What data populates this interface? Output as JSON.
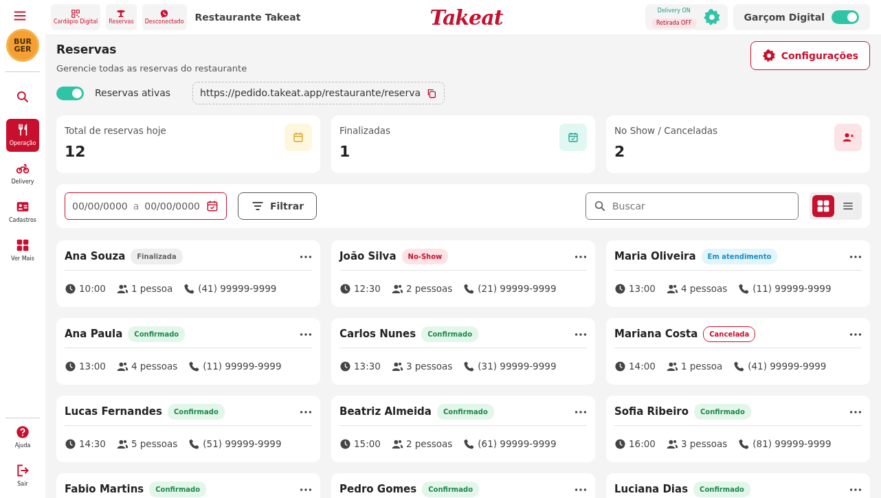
{
  "topbar": {
    "shortcuts": [
      {
        "label": "Cardápio Digital"
      },
      {
        "label": "Reservas"
      },
      {
        "label": "Desconectado"
      }
    ],
    "restaurant": "Restaurante Takeat",
    "logo": "Takeat",
    "services": [
      {
        "label": "Delivery ON",
        "on": true
      },
      {
        "label": "Retirada OFF",
        "on": false
      }
    ],
    "waiter": {
      "label": "Garçom Digital",
      "on": true
    }
  },
  "sidebar": {
    "avatar": [
      "BUR",
      "GER"
    ],
    "items": [
      {
        "selected": false
      },
      {
        "label": "Operação",
        "selected": true
      },
      {
        "label": "Delivery",
        "selected": false
      },
      {
        "label": "Cadastros",
        "selected": false
      },
      {
        "label": "Ver Mais",
        "selected": false
      }
    ],
    "bottom": [
      {
        "label": "Ajuda"
      },
      {
        "label": "Sair"
      }
    ]
  },
  "page": {
    "title": "Reservas",
    "subtitle": "Gerencie todas as reservas do restaurante",
    "settings_button": "Configurações",
    "active_toggle": {
      "label": "Reservas ativas",
      "on": true
    },
    "link": "https://pedido.takeat.app/restaurante/reserva"
  },
  "stats": [
    {
      "label": "Total de reservas hoje",
      "value": "12",
      "kind": "total"
    },
    {
      "label": "Finalizadas",
      "value": "1",
      "kind": "done"
    },
    {
      "label": "No Show / Canceladas",
      "value": "2",
      "kind": "cancel"
    }
  ],
  "filters": {
    "date_from": "00/00/0000",
    "separator": "a",
    "date_to": "00/00/0000",
    "filter_button": "Filtrar",
    "search_placeholder": "Buscar",
    "views": [
      {
        "kind": "grid",
        "selected": true
      },
      {
        "kind": "list",
        "selected": false
      }
    ]
  },
  "reservations": [
    {
      "name": "Ana Souza",
      "status": "Finalizada",
      "kind": "finalizada",
      "time": "10:00",
      "people": "1 pessoa",
      "phone": "(41) 99999-9999"
    },
    {
      "name": "João Silva",
      "status": "No-Show",
      "kind": "noshow",
      "time": "12:30",
      "people": "2 pessoas",
      "phone": "(21) 99999-9999"
    },
    {
      "name": "Maria Oliveira",
      "status": "Em atendimento",
      "kind": "atendimento",
      "time": "13:00",
      "people": "4 pessoas",
      "phone": "(11) 99999-9999"
    },
    {
      "name": "Ana Paula",
      "status": "Confirmado",
      "kind": "confirmado",
      "time": "13:00",
      "people": "4 pessoas",
      "phone": "(11) 99999-9999"
    },
    {
      "name": "Carlos Nunes",
      "status": "Confirmado",
      "kind": "confirmado",
      "time": "13:30",
      "people": "3 pessoas",
      "phone": "(31) 99999-9999"
    },
    {
      "name": "Mariana Costa",
      "status": "Cancelada",
      "kind": "cancelada",
      "time": "14:00",
      "people": "1 pessoa",
      "phone": "(41) 99999-9999"
    },
    {
      "name": "Lucas Fernandes",
      "status": "Confirmado",
      "kind": "confirmado",
      "time": "14:30",
      "people": "5 pessoas",
      "phone": "(51) 99999-9999"
    },
    {
      "name": "Beatriz Almeida",
      "status": "Confirmado",
      "kind": "confirmado",
      "time": "15:00",
      "people": "2 pessoas",
      "phone": "(61) 99999-9999"
    },
    {
      "name": "Sofia Ribeiro",
      "status": "Confirmado",
      "kind": "confirmado",
      "time": "16:00",
      "people": "3 pessoas",
      "phone": "(81) 99999-9999"
    },
    {
      "name": "Fabio Martins",
      "status": "Confirmado",
      "kind": "confirmado"
    },
    {
      "name": "Pedro Gomes",
      "status": "Confirmado",
      "kind": "confirmado"
    },
    {
      "name": "Luciana Dias",
      "status": "Confirmado",
      "kind": "confirmado"
    }
  ]
}
